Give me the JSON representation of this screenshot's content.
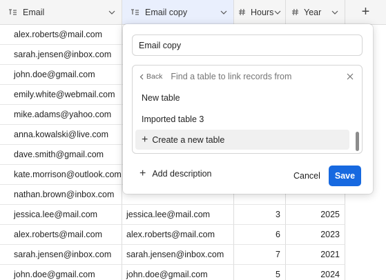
{
  "columns": [
    {
      "label": "Email",
      "icon": "long-text-icon"
    },
    {
      "label": "Email copy",
      "icon": "long-text-icon"
    },
    {
      "label": "Hours",
      "icon": "number-icon"
    },
    {
      "label": "Year",
      "icon": "number-icon"
    }
  ],
  "add_column_label": "+",
  "rows": [
    {
      "email": "alex.roberts@mail.com",
      "copy": "",
      "hours": "",
      "year": ""
    },
    {
      "email": "sarah.jensen@inbox.com",
      "copy": "",
      "hours": "",
      "year": ""
    },
    {
      "email": "john.doe@gmail.com",
      "copy": "",
      "hours": "",
      "year": ""
    },
    {
      "email": "emily.white@webmail.com",
      "copy": "",
      "hours": "",
      "year": ""
    },
    {
      "email": "mike.adams@yahoo.com",
      "copy": "",
      "hours": "",
      "year": ""
    },
    {
      "email": "anna.kowalski@live.com",
      "copy": "",
      "hours": "",
      "year": ""
    },
    {
      "email": "dave.smith@gmail.com",
      "copy": "",
      "hours": "",
      "year": ""
    },
    {
      "email": "kate.morrison@outlook.com",
      "copy": "",
      "hours": "",
      "year": ""
    },
    {
      "email": "nathan.brown@inbox.com",
      "copy": "",
      "hours": "",
      "year": ""
    },
    {
      "email": "jessica.lee@mail.com",
      "copy": "jessica.lee@mail.com",
      "hours": "3",
      "year": "2025"
    },
    {
      "email": "alex.roberts@mail.com",
      "copy": "alex.roberts@mail.com",
      "hours": "6",
      "year": "2023"
    },
    {
      "email": "sarah.jensen@inbox.com",
      "copy": "sarah.jensen@inbox.com",
      "hours": "7",
      "year": "2021"
    },
    {
      "email": "john.doe@gmail.com",
      "copy": "john.doe@gmail.com",
      "hours": "5",
      "year": "2024"
    }
  ],
  "dialog": {
    "field_name": "Email copy",
    "back_label": "Back",
    "search_placeholder": "Find a table to link records from",
    "options": [
      {
        "label": "New table"
      },
      {
        "label": "Imported table 3"
      }
    ],
    "create_label": "Create a new table",
    "add_description_label": "Add description",
    "cancel_label": "Cancel",
    "save_label": "Save"
  },
  "colors": {
    "accent": "#1769e0",
    "active_header": "#e9effd",
    "header_bg": "#f5f5f5"
  }
}
